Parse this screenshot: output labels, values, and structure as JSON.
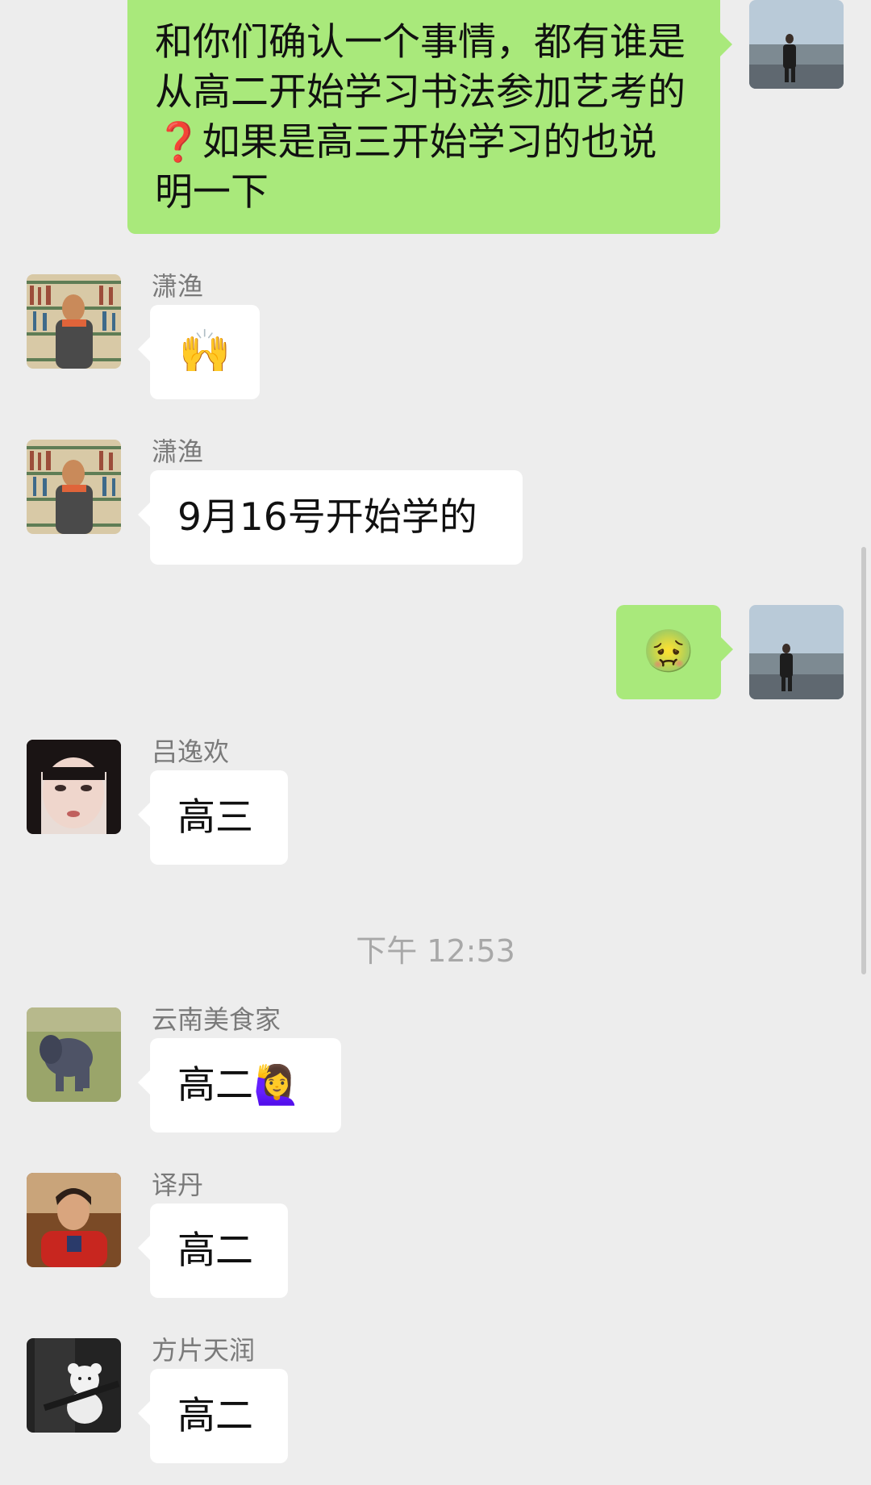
{
  "messages": {
    "m1": {
      "text": "和你们确认一个事情，都有谁是从高二开始学习书法参加艺考的❓如果是高三开始学习的也说明一下"
    },
    "m2": {
      "sender": "潇渔",
      "text": "🙌"
    },
    "m3": {
      "sender": "潇渔",
      "text": "9月16号开始学的"
    },
    "m4": {
      "text": "🤢"
    },
    "m5": {
      "sender": "吕逸欢",
      "text": "高三"
    },
    "m6": {
      "sender": "云南美食家",
      "text": "高二🙋‍♀️"
    },
    "m7": {
      "sender": "译丹",
      "text": "高二"
    },
    "m8": {
      "sender": "方片天润",
      "text": "高二"
    }
  },
  "timestamp": "下午 12:53",
  "colors": {
    "background": "#ededed",
    "outgoing_bubble": "#a9e97b",
    "incoming_bubble": "#ffffff"
  }
}
